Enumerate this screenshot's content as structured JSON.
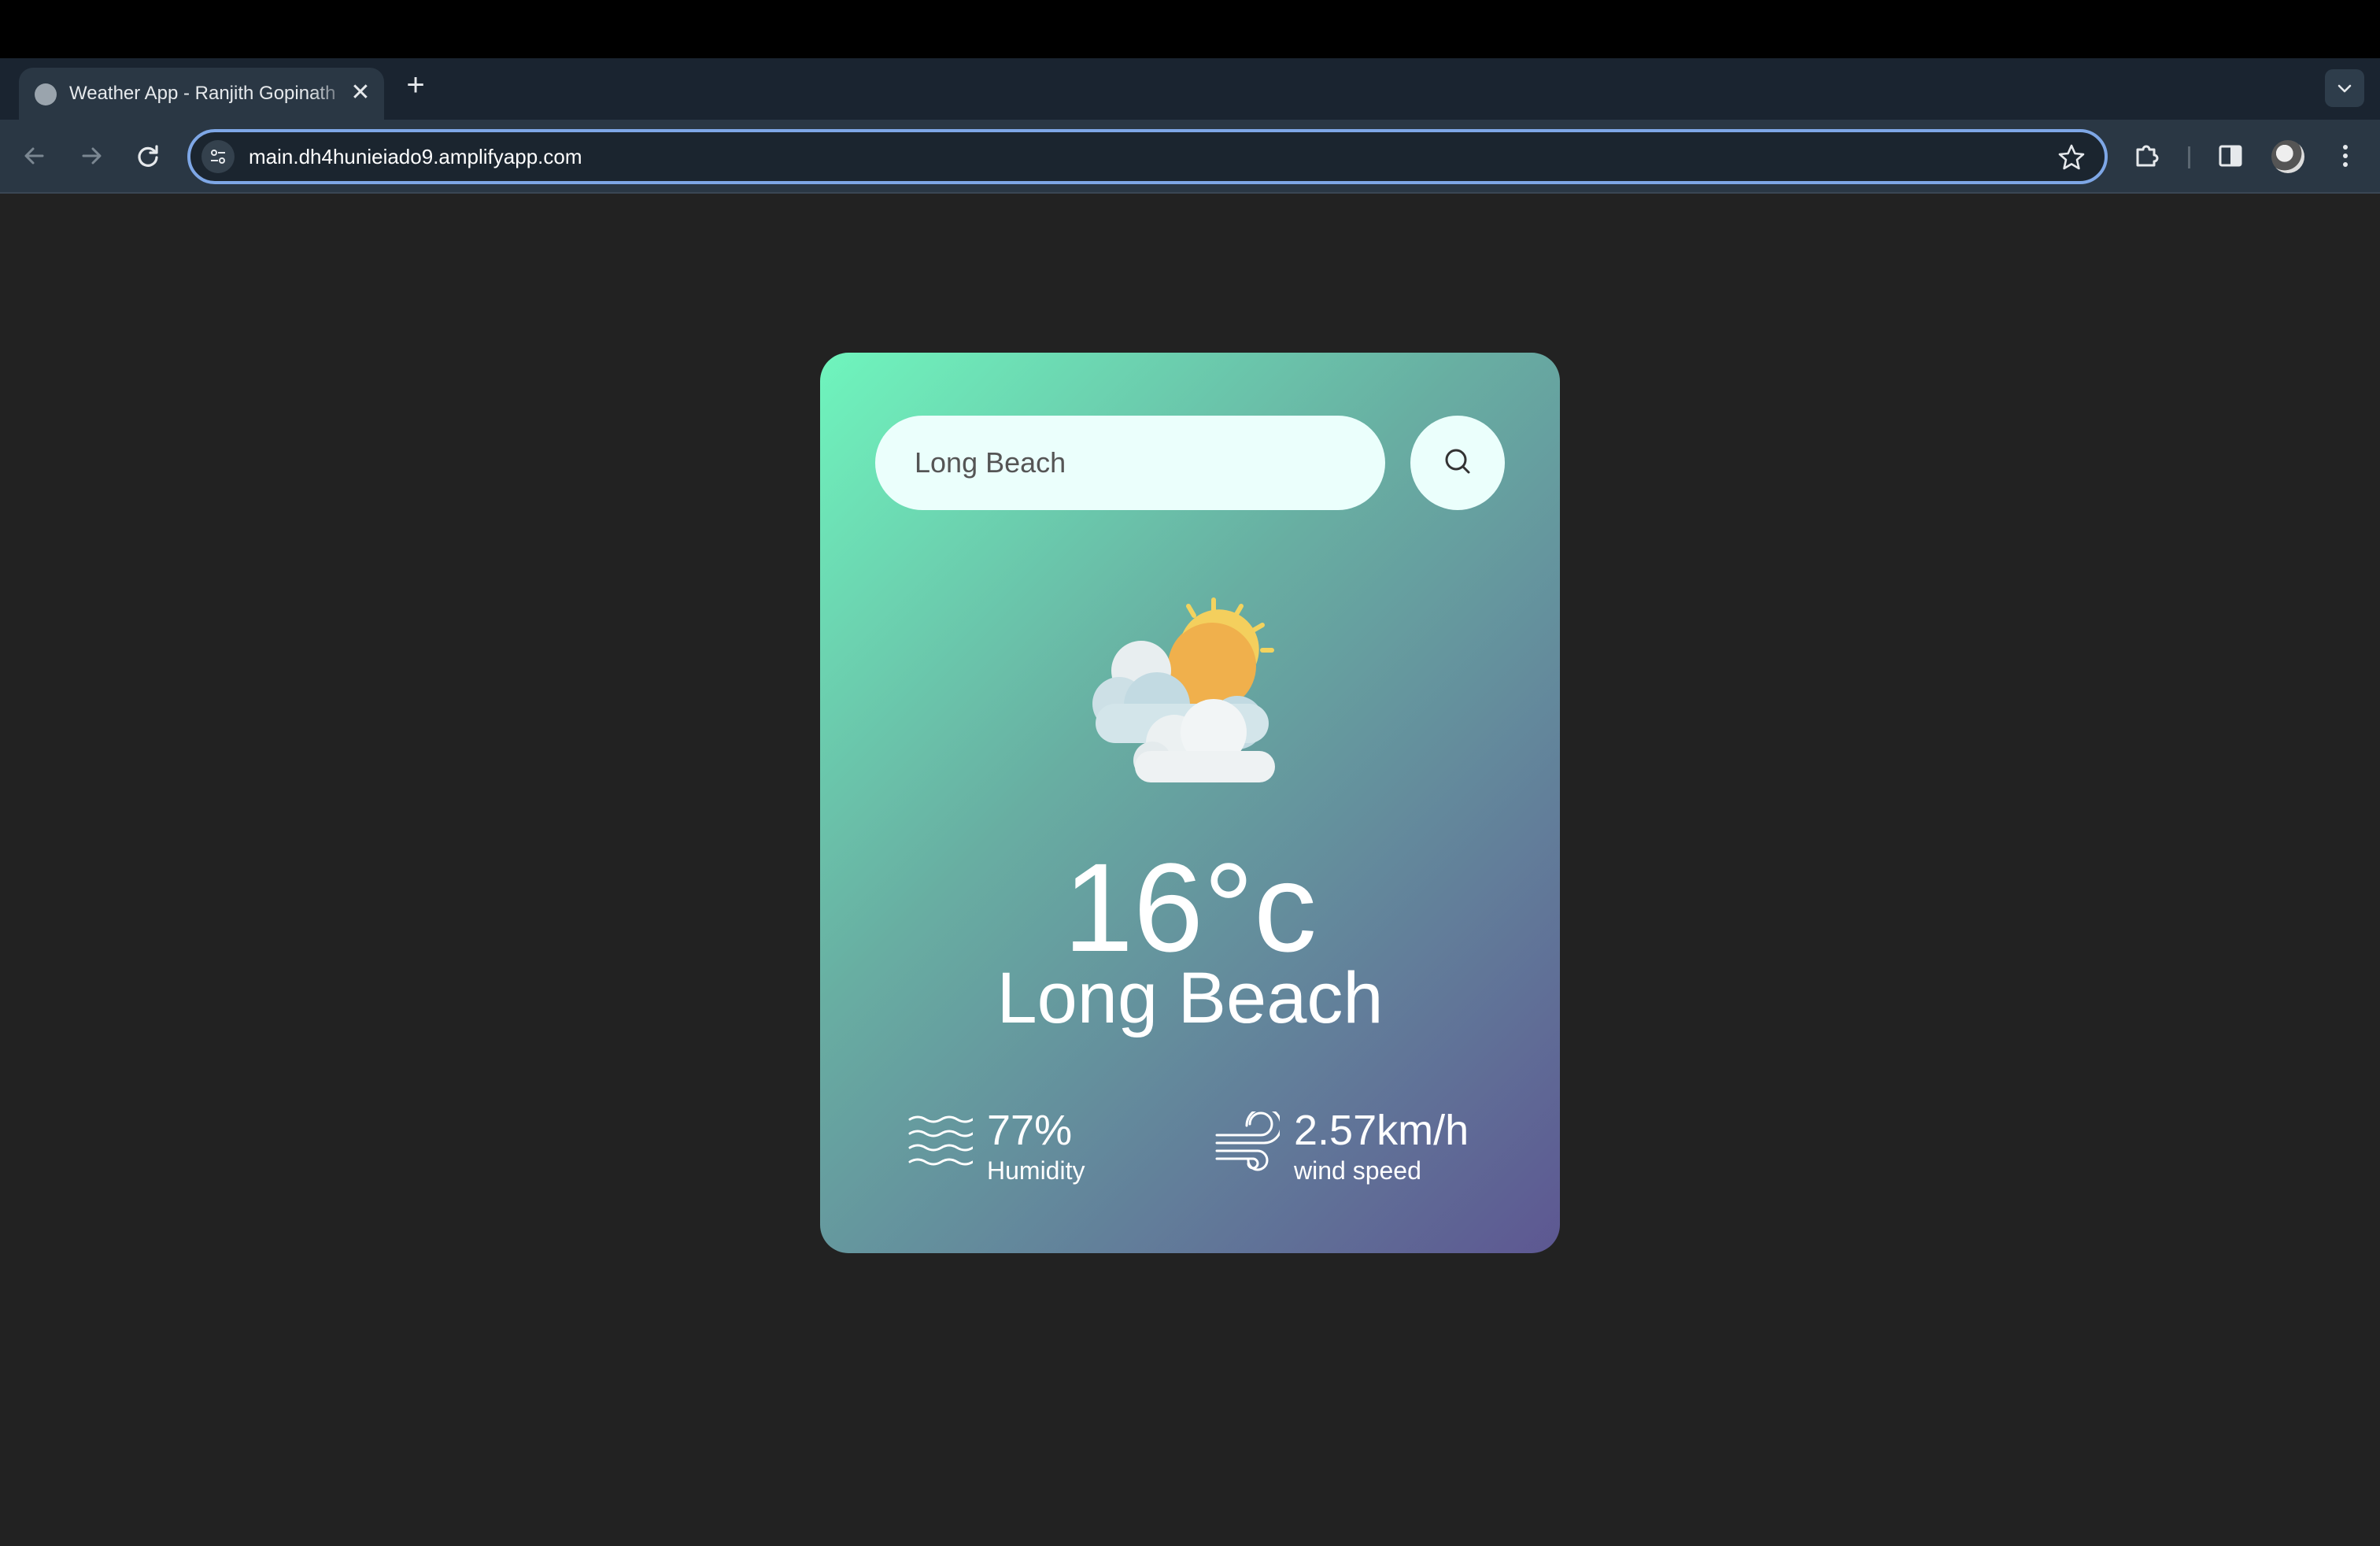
{
  "browser": {
    "tab_title": "Weather App - Ranjith Gopinath",
    "tab_close": "✕",
    "new_tab": "+",
    "url": "main.dh4hunieiado9.amplifyapp.com"
  },
  "weather": {
    "search_value": "Long Beach",
    "temperature": "16°c",
    "city": "Long Beach",
    "condition_icon": "partly-cloudy-icon",
    "humidity": {
      "value": "77%",
      "label": "Humidity"
    },
    "wind": {
      "value": "2.57km/h",
      "label": "wind speed"
    }
  },
  "colors": {
    "page_background": "#222222",
    "card_gradient_start": "#6ff5bd",
    "card_gradient_end": "#5d5792",
    "input_background": "#ebfffc",
    "text": "#ffffff"
  }
}
